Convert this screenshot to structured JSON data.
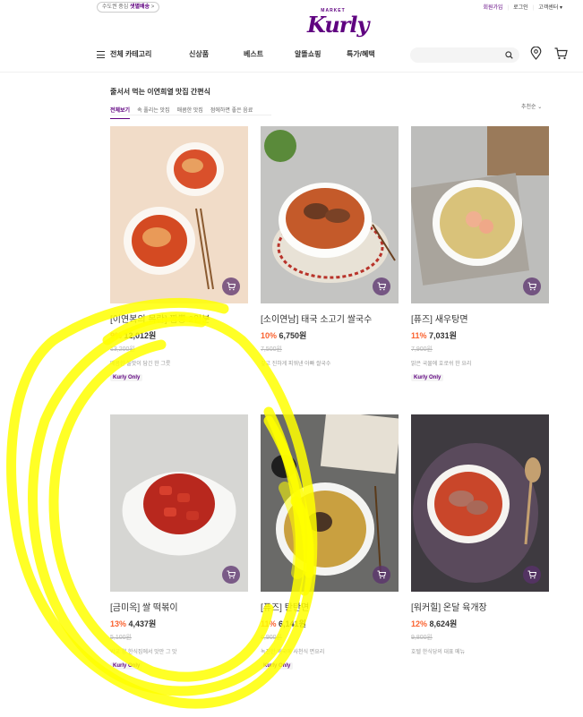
{
  "header": {
    "delivery_prefix": "수도권 중심 ",
    "delivery_highlight": "샛별배송",
    "delivery_suffix": " >",
    "signup": "회원가입",
    "login": "로그인",
    "customer_center": "고객센터 ▾",
    "logo_market": "MARKET",
    "logo_kurly": "Kurly"
  },
  "gnb": {
    "all_category": "전체 카테고리",
    "menu": [
      "신상품",
      "베스트",
      "알뜰쇼핑",
      "특가/혜택"
    ],
    "search_placeholder": ""
  },
  "section": {
    "title": "줄서서 먹는 이연희열 맛집 간편식",
    "tabs": [
      "전체보기",
      "속 풀리는 맛집",
      "매콤한 맛집",
      "점에하면 좋은 음료"
    ],
    "sort": "추천순 ⌄"
  },
  "products": [
    {
      "name": "[이연복의 목란] 짬뽕 2인분",
      "discount": "9%",
      "price": "12,012원",
      "original": "13,200원",
      "desc": "매콤한 불맛이 담긴 한 그릇",
      "badge": "Kurly Only"
    },
    {
      "name": "[소이연남] 태국 소고기 쌀국수",
      "discount": "10%",
      "price": "6,750원",
      "original": "7,500원",
      "desc": "깊고 진하게 피워낸 아빠 쌀국수",
      "badge": ""
    },
    {
      "name": "[퓨즈] 새우탕면",
      "discount": "11%",
      "price": "7,031원",
      "original": "7,900원",
      "desc": "맑은 국물에 호로쉬 한 요리",
      "badge": "Kurly Only"
    },
    {
      "name": "[금미옥] 쌀 떡볶이",
      "discount": "13%",
      "price": "4,437원",
      "original": "5,100원",
      "desc": "박교 양 한식집에서 맛만 그 맛",
      "badge": "Kurly Only"
    },
    {
      "name": "[퓨즈] 탄탄면",
      "discount": "11%",
      "price": "6,141원",
      "original": "6,900원",
      "desc": "녹진한 깨국에 사천식 면요리",
      "badge": "Kurly Only"
    },
    {
      "name": "[워커힐] 온달 육개장",
      "discount": "12%",
      "price": "8,624원",
      "original": "9,800원",
      "desc": "호텔 한식당의 대표 메뉴",
      "badge": ""
    }
  ],
  "colors": {
    "brand": "#5f0080",
    "discount": "#fa622f",
    "scribble": "#ffff00"
  }
}
